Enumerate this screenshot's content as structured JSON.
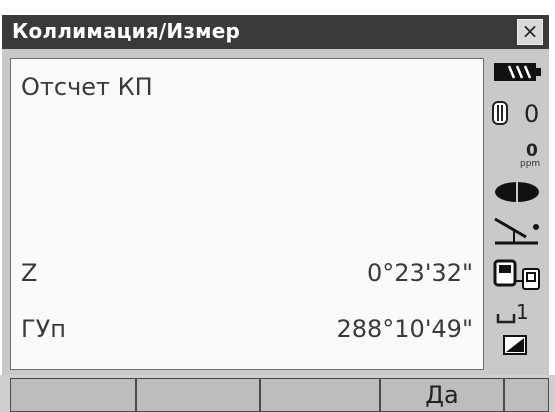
{
  "window": {
    "title": "Коллимация/Измер",
    "close_label": "×"
  },
  "panel": {
    "heading": "Отсчет КП",
    "rows": [
      {
        "label": "Z",
        "value": "0°23'32\""
      },
      {
        "label": "ГУп",
        "value": "288°10'49\""
      }
    ]
  },
  "status": {
    "ppm_value": "0",
    "ppm_unit": "ppm",
    "prism_const": "0",
    "input_mode": "1"
  },
  "softkeys": [
    "",
    "",
    "",
    "Да"
  ],
  "icons": [
    "battery-icon",
    "prism-icon",
    "ppm-icon",
    "tilt-bubble-icon",
    "compensator-icon",
    "comm-icon",
    "input-mode-icon",
    "sd-card-icon"
  ]
}
